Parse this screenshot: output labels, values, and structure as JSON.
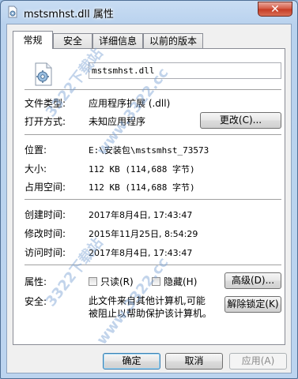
{
  "window": {
    "title": "mstsmhst.dll 属性",
    "close_glyph": "✕"
  },
  "tabs": [
    {
      "label": "常规"
    },
    {
      "label": "安全"
    },
    {
      "label": "详细信息"
    },
    {
      "label": "以前的版本"
    }
  ],
  "general": {
    "filename": "mstsmhst.dll",
    "file_type_label": "文件类型:",
    "file_type_value": "应用程序扩展 (.dll)",
    "opens_with_label": "打开方式:",
    "opens_with_value": "未知应用程序",
    "change_button": "更改(C)...",
    "location_label": "位置:",
    "location_value": "E:\\安装包\\mstsmhst_73573",
    "size_label": "大小:",
    "size_value": "112 KB (114,688 字节)",
    "size_on_disk_label": "占用空间:",
    "size_on_disk_value": "112 KB (114,688 字节)",
    "created_label": "创建时间:",
    "created_value": "2017年8月4日, 17:43:47",
    "modified_label": "修改时间:",
    "modified_value": "2015年11月25日, 8:54:29",
    "accessed_label": "访问时间:",
    "accessed_value": "2017年8月4日, 17:43:47",
    "attributes_label": "属性:",
    "readonly_label": "只读(R)",
    "hidden_label": "隐藏(H)",
    "advanced_button": "高级(D)...",
    "security_label": "安全:",
    "security_text_line1": "此文件来自其他计算机,可能",
    "security_text_line2": "被阻止以帮助保护该计算机。",
    "unblock_button": "解除锁定(K)"
  },
  "footer": {
    "ok_button": "确定",
    "cancel_button": "取消",
    "apply_button": "应用(A)"
  },
  "watermark": {
    "text1": "3322下载站",
    "text2": "www.3322.cc"
  }
}
